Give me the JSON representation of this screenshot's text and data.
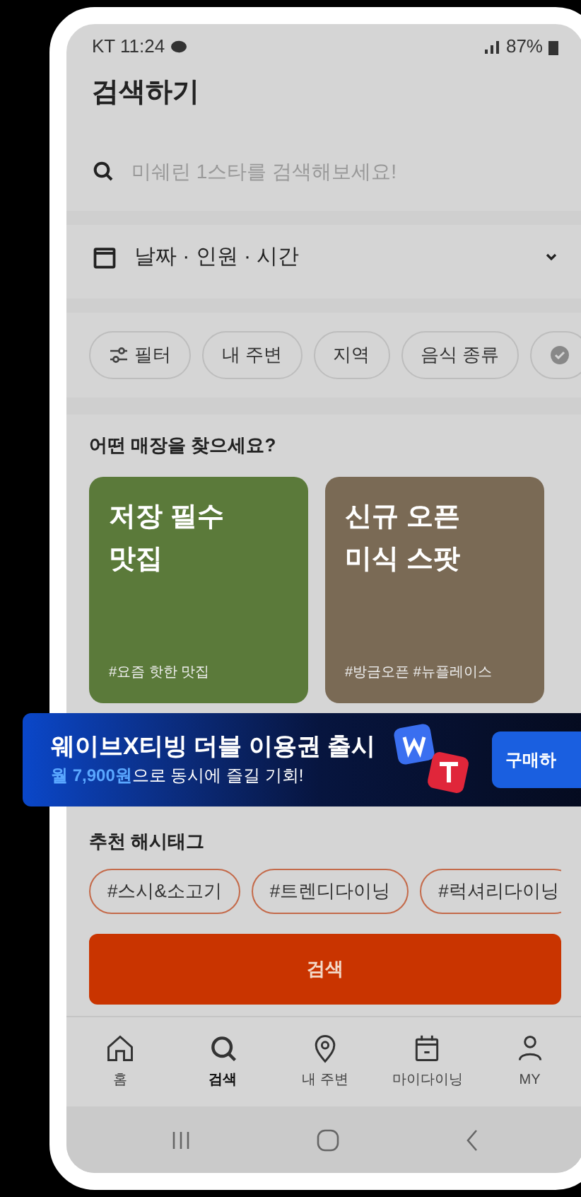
{
  "status_bar": {
    "carrier_time": "KT 11:24",
    "battery": "87%"
  },
  "title": "검색하기",
  "search": {
    "placeholder": "미쉐린 1스타를 검색해보세요!"
  },
  "date_selector": {
    "label": "날짜 · 인원 · 시간"
  },
  "filter_chips": [
    {
      "kind": "filter",
      "label": "필터"
    },
    {
      "kind": "plain",
      "label": "내 주변"
    },
    {
      "kind": "plain",
      "label": "지역"
    },
    {
      "kind": "plain",
      "label": "음식 종류"
    },
    {
      "kind": "badge"
    }
  ],
  "store_section": {
    "heading": "어떤 매장을 찾으세요?",
    "cards": [
      {
        "title": "저장 필수\n맛집",
        "tags": "#요즘 핫한 맛집",
        "color": "#5b7a3a"
      },
      {
        "title": "신규 오픈\n미식 스팟",
        "tags": "#방금오픈 #뉴플레이스",
        "color": "#7a6a55"
      }
    ]
  },
  "ad_banner": {
    "headline": "웨이브X티빙 더블 이용권 출시",
    "subline": "**월 7,900원**으로 동시에 즐길 기회!",
    "button": "구매하"
  },
  "hashtag_section": {
    "heading": "추천 해시태그",
    "tags": [
      "#스시&소고기",
      "#트렌디다이닝",
      "#럭셔리다이닝"
    ]
  },
  "search_button": "검색",
  "bottom_nav": [
    {
      "kind": "home",
      "label": "홈",
      "selected": false
    },
    {
      "kind": "search",
      "label": "검색",
      "selected": true
    },
    {
      "kind": "pin",
      "label": "내 주변",
      "selected": false
    },
    {
      "kind": "calendar",
      "label": "마이다이닝",
      "selected": false
    },
    {
      "kind": "person",
      "label": "MY",
      "selected": false
    }
  ]
}
